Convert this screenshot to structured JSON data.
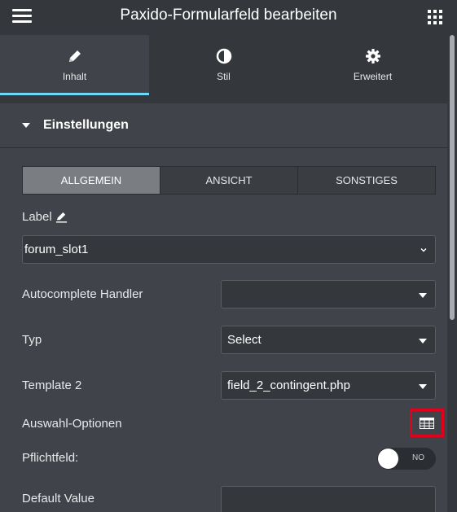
{
  "topbar": {
    "title": "Paxido-Formularfeld bearbeiten",
    "menu_icon": "hamburger-icon",
    "apps_icon": "grid-icon"
  },
  "tabs": [
    {
      "label": "Inhalt",
      "icon": "pencil-icon",
      "active": true
    },
    {
      "label": "Stil",
      "icon": "contrast-icon",
      "active": false
    },
    {
      "label": "Erweitert",
      "icon": "gear-icon",
      "active": false
    }
  ],
  "section": {
    "title": "Einstellungen"
  },
  "subtabs": [
    {
      "label": "ALLGEMEIN",
      "active": true
    },
    {
      "label": "ANSICHT",
      "active": false
    },
    {
      "label": "SONSTIGES",
      "active": false
    }
  ],
  "fields": {
    "label_title": "Label",
    "label_value": "forum_slot1",
    "autocomplete_label": "Autocomplete Handler",
    "autocomplete_value": "",
    "typ_label": "Typ",
    "typ_value": "Select",
    "template_label": "Template 2",
    "template_value": "field_2_contingent.php",
    "options_label": "Auswahl-Optionen",
    "required_label": "Pflichtfeld:",
    "required_toggle": "NO",
    "default_label": "Default Value",
    "default_value": ""
  },
  "colors": {
    "accent": "#71d7f7",
    "highlight_box": "#e2001a",
    "panel_bg": "#404349",
    "header_bg": "#34383c"
  }
}
